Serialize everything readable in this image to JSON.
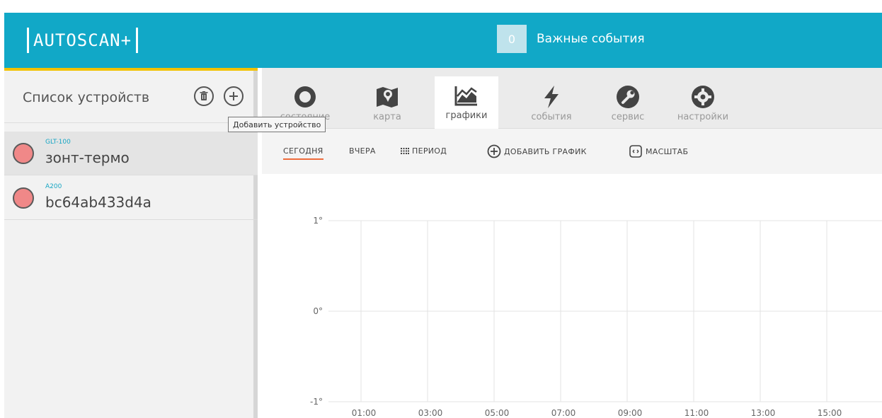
{
  "header": {
    "logo_text": "AUTOSCAN+",
    "events_count": "0",
    "events_label": "Важные события",
    "bg_color": "#11a8c7"
  },
  "sidebar": {
    "title": "Список устройств",
    "delete_icon": "trash-icon",
    "add_icon": "plus-circle-icon",
    "tooltip": "Добавить устройство",
    "devices": [
      {
        "model": "GLT-100",
        "name": "зонт-термо",
        "status_color": "#f08888"
      },
      {
        "model": "A200",
        "name": "bc64ab433d4a",
        "status_color": "#f08888"
      }
    ]
  },
  "tabs": [
    {
      "label": "состояние",
      "icon": "circle-icon"
    },
    {
      "label": "карта",
      "icon": "map-icon"
    },
    {
      "label": "графики",
      "icon": "chart-icon",
      "active": true
    },
    {
      "label": "события",
      "icon": "lightning-icon"
    },
    {
      "label": "сервис",
      "icon": "wrench-icon"
    },
    {
      "label": "настройки",
      "icon": "gear-icon"
    }
  ],
  "toolbar": {
    "today": "СЕГОДНЯ",
    "yesterday": "ВЧЕРА",
    "period": "ПЕРИОД",
    "add_chart": "ДОБАВИТЬ ГРАФИК",
    "scale": "МАСШТАБ"
  },
  "chart_data": {
    "type": "line",
    "title": "",
    "xlabel": "",
    "ylabel": "",
    "x_ticks": [
      "01:00",
      "03:00",
      "05:00",
      "07:00",
      "09:00",
      "11:00",
      "13:00",
      "15:00"
    ],
    "y_ticks": [
      "1°",
      "0°",
      "-1°"
    ],
    "ylim": [
      -1,
      1
    ],
    "grid": true,
    "series": []
  }
}
